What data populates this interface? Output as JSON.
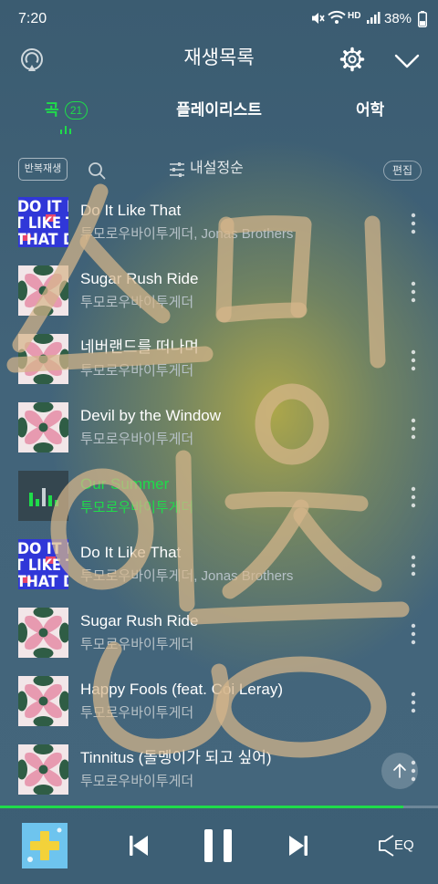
{
  "status_bar": {
    "time": "7:20",
    "network_label": "HD",
    "battery": "38%",
    "battery_level": 0.38
  },
  "header": {
    "title": "재생목록"
  },
  "tabs": {
    "songs": {
      "label": "곡",
      "count": "21"
    },
    "playlists": {
      "label": "플레이리스트"
    },
    "language": {
      "label": "어학"
    },
    "active": "songs"
  },
  "toolbar": {
    "repeat_label": "반복재생",
    "sort_label": "내설정순",
    "edit_label": "편집"
  },
  "songs": [
    {
      "title": "Do It Like That",
      "artist": "투모로우바이투게더, Jonas Brothers",
      "art": "do_it_like_that",
      "playing": false
    },
    {
      "title": "Sugar Rush Ride",
      "artist": "투모로우바이투게더",
      "art": "temptation",
      "playing": false
    },
    {
      "title": "네버랜드를 떠나며",
      "artist": "투모로우바이투게더",
      "art": "temptation",
      "playing": false
    },
    {
      "title": "Devil by the Window",
      "artist": "투모로우바이투게더",
      "art": "temptation",
      "playing": false
    },
    {
      "title": "Our Summer",
      "artist": "투모로우바이투게더",
      "art": "now_playing",
      "playing": true
    },
    {
      "title": "Do It Like That",
      "artist": "투모로우바이투게더, Jonas Brothers",
      "art": "do_it_like_that",
      "playing": false
    },
    {
      "title": "Sugar Rush Ride",
      "artist": "투모로우바이투게더",
      "art": "temptation",
      "playing": false
    },
    {
      "title": "Happy Fools (feat. Coi Leray)",
      "artist": "투모로우바이투게더",
      "art": "temptation",
      "playing": false
    },
    {
      "title": "Tinnitus (돌멩이가 되고 싶어)",
      "artist": "투모로우바이투게더",
      "art": "temptation",
      "playing": false
    }
  ],
  "art_text": {
    "do_it_like_that": [
      "DO IT L",
      "T LIKE T",
      "THAT D"
    ]
  },
  "player": {
    "progress": 0.92,
    "eq_label": "EQ"
  },
  "icons": {
    "cast": "cast-icon",
    "settings": "gear-icon",
    "collapse": "chevron-down-icon",
    "search": "search-icon",
    "sort": "sliders-icon",
    "more": "more-vertical-icon",
    "scroll_top": "arrow-up-icon",
    "previous": "skip-previous-icon",
    "pause": "pause-icon",
    "next": "skip-next-icon",
    "equalizer": "eq-icon"
  },
  "colors": {
    "accent": "#1fdc4a",
    "background": "#42647a",
    "glow": "#b2aa48",
    "text_secondary": "#b6c1c7",
    "handwriting": "#d6b68a"
  }
}
